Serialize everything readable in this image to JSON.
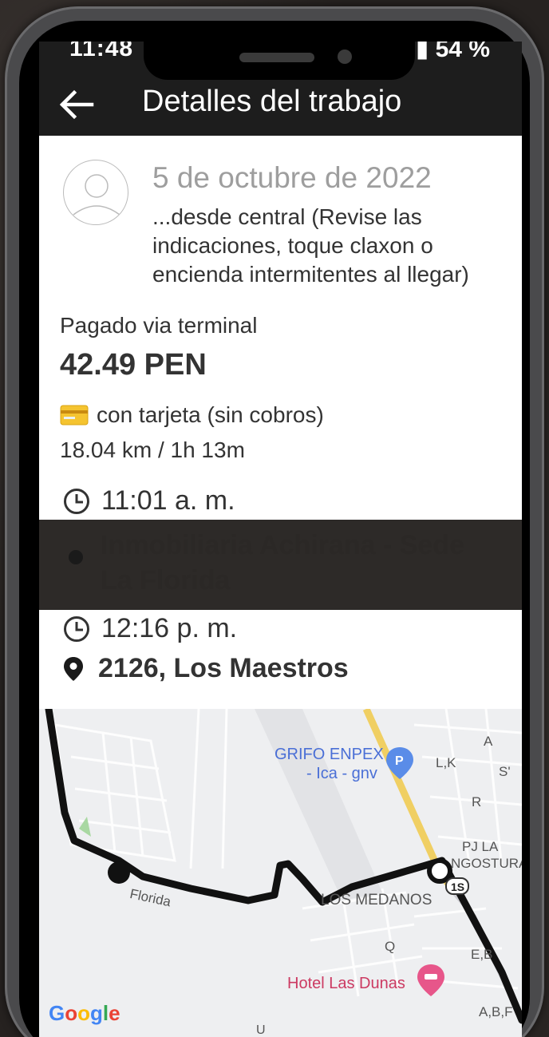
{
  "status_bar": {
    "time": "11:48",
    "battery": "54 %"
  },
  "app_bar": {
    "title": "Detalles del trabajo"
  },
  "trip": {
    "date": "5 de octubre de 2022",
    "note": "...desde central (Revise las indicaciones, toque claxon o encienda intermitentes al llegar)",
    "payment_method": "Pagado via terminal",
    "price": "42.49 PEN",
    "card_text": "con tarjeta (sin cobros)",
    "distance_duration": "18.04 km / 1h 13m",
    "pickup_time": "11:01 a. m.",
    "pickup_place": "Inmobiliaria Achirana - Sede La Florida",
    "dropoff_time": "12:16 p. m.",
    "dropoff_address": "2126, Los Maestros"
  },
  "map": {
    "labels": {
      "grifo": "GRIFO ENPEX",
      "grifo_sub": "- Ica - gnv",
      "lk": "L,K",
      "a": "A",
      "s": "S'",
      "r": "R",
      "pj_la": "PJ LA",
      "angostura": "NGOSTURA",
      "los_medanos": "LOS MEDANOS",
      "route_1s": "1S",
      "florida": "Florida",
      "q": "Q",
      "eb": "E,B",
      "hotel": "Hotel Las Dunas",
      "abf": "A,B,F",
      "u": "U",
      "google": "Google"
    }
  },
  "colors": {
    "app_bar": "#1d1d1d",
    "route": "#111111",
    "highway": "#f3d36b",
    "poi_blue": "#4a6fd6",
    "poi_pink": "#cc3a62"
  }
}
